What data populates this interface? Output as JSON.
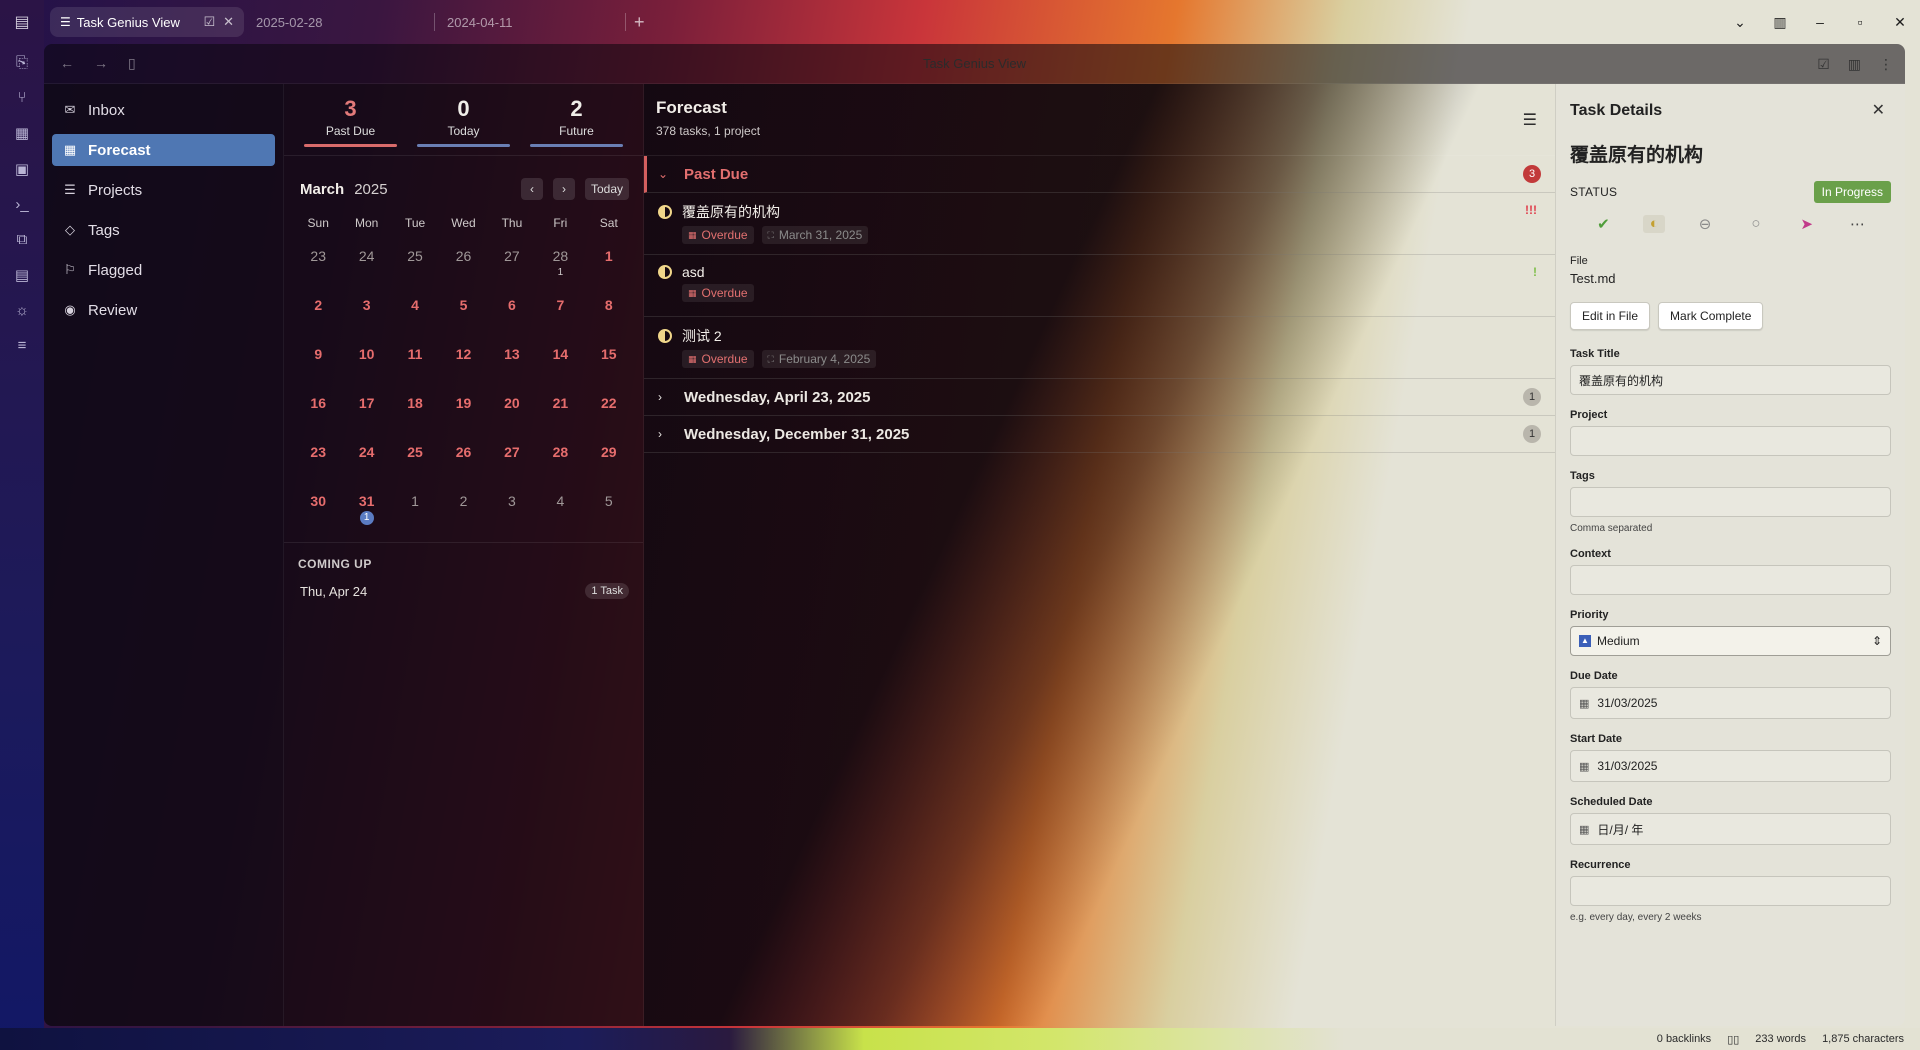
{
  "tabs": [
    {
      "label": "Task Genius View",
      "active": true
    },
    {
      "label": "2025-02-28",
      "active": false
    },
    {
      "label": "2024-04-11",
      "active": false
    }
  ],
  "window": {
    "title": "Task Genius View"
  },
  "sidebar": {
    "items": [
      {
        "label": "Inbox",
        "icon": "inbox-icon"
      },
      {
        "label": "Forecast",
        "icon": "calendar-icon",
        "active": true
      },
      {
        "label": "Projects",
        "icon": "list-icon"
      },
      {
        "label": "Tags",
        "icon": "tag-icon"
      },
      {
        "label": "Flagged",
        "icon": "flag-icon"
      },
      {
        "label": "Review",
        "icon": "eye-icon"
      }
    ]
  },
  "stats": {
    "past_due": {
      "value": "3",
      "label": "Past Due"
    },
    "today": {
      "value": "0",
      "label": "Today"
    },
    "future": {
      "value": "2",
      "label": "Future"
    }
  },
  "calendar": {
    "month": "March",
    "year": "2025",
    "today_label": "Today",
    "weekdays": [
      "Sun",
      "Mon",
      "Tue",
      "Wed",
      "Thu",
      "Fri",
      "Sat"
    ],
    "days": [
      {
        "d": "23",
        "m": true
      },
      {
        "d": "24",
        "m": true
      },
      {
        "d": "25",
        "m": true
      },
      {
        "d": "26",
        "m": true
      },
      {
        "d": "27",
        "m": true
      },
      {
        "d": "28",
        "m": true,
        "c": "1"
      },
      {
        "d": "1"
      },
      {
        "d": "2"
      },
      {
        "d": "3"
      },
      {
        "d": "4"
      },
      {
        "d": "5"
      },
      {
        "d": "6"
      },
      {
        "d": "7"
      },
      {
        "d": "8"
      },
      {
        "d": "9"
      },
      {
        "d": "10"
      },
      {
        "d": "11"
      },
      {
        "d": "12"
      },
      {
        "d": "13"
      },
      {
        "d": "14"
      },
      {
        "d": "15"
      },
      {
        "d": "16"
      },
      {
        "d": "17"
      },
      {
        "d": "18"
      },
      {
        "d": "19"
      },
      {
        "d": "20"
      },
      {
        "d": "21"
      },
      {
        "d": "22"
      },
      {
        "d": "23"
      },
      {
        "d": "24"
      },
      {
        "d": "25"
      },
      {
        "d": "26"
      },
      {
        "d": "27"
      },
      {
        "d": "28"
      },
      {
        "d": "29"
      },
      {
        "d": "30"
      },
      {
        "d": "31",
        "c": "1",
        "blue": true
      },
      {
        "d": "1",
        "m": true
      },
      {
        "d": "2",
        "m": true
      },
      {
        "d": "3",
        "m": true
      },
      {
        "d": "4",
        "m": true
      },
      {
        "d": "5",
        "m": true
      }
    ]
  },
  "coming_up": {
    "header": "COMING UP",
    "items": [
      {
        "date": "Thu, Apr 24",
        "badge": "1 Task"
      }
    ]
  },
  "forecast": {
    "title": "Forecast",
    "subtitle": "378 tasks, 1 project",
    "past_due": {
      "label": "Past Due",
      "count": "3"
    },
    "tasks": [
      {
        "name": "覆盖原有的机构",
        "overdue": "Overdue",
        "date": "March 31, 2025",
        "priority": "!!!"
      },
      {
        "name": "asd",
        "overdue": "Overdue",
        "date": "",
        "priority": "!"
      },
      {
        "name": "测试 2",
        "overdue": "Overdue",
        "date": "February 4, 2025",
        "priority": ""
      }
    ],
    "groups": [
      {
        "label": "Wednesday, April 23, 2025",
        "count": "1"
      },
      {
        "label": "Wednesday, December 31, 2025",
        "count": "1"
      }
    ]
  },
  "details": {
    "header": "Task Details",
    "task_title": "覆盖原有的机构",
    "status_label": "STATUS",
    "status_value": "In Progress",
    "file_label": "File",
    "file_value": "Test.md",
    "edit_btn": "Edit in File",
    "complete_btn": "Mark Complete",
    "fields": {
      "task_title_label": "Task Title",
      "task_title_value": "覆盖原有的机构",
      "project_label": "Project",
      "tags_label": "Tags",
      "tags_hint": "Comma separated",
      "context_label": "Context",
      "priority_label": "Priority",
      "priority_value": "Medium",
      "due_label": "Due Date",
      "due_value": "31/03/2025",
      "start_label": "Start Date",
      "start_value": "31/03/2025",
      "scheduled_label": "Scheduled Date",
      "scheduled_value": "日/月/ 年",
      "recurrence_label": "Recurrence",
      "recurrence_hint": "e.g. every day, every 2 weeks"
    }
  },
  "statusbar": {
    "backlinks": "0 backlinks",
    "words": "233 words",
    "chars": "1,875 characters"
  },
  "colors": {
    "accent": "#4f77b3",
    "overdue": "#e27070",
    "progress": "#6aa04a"
  }
}
